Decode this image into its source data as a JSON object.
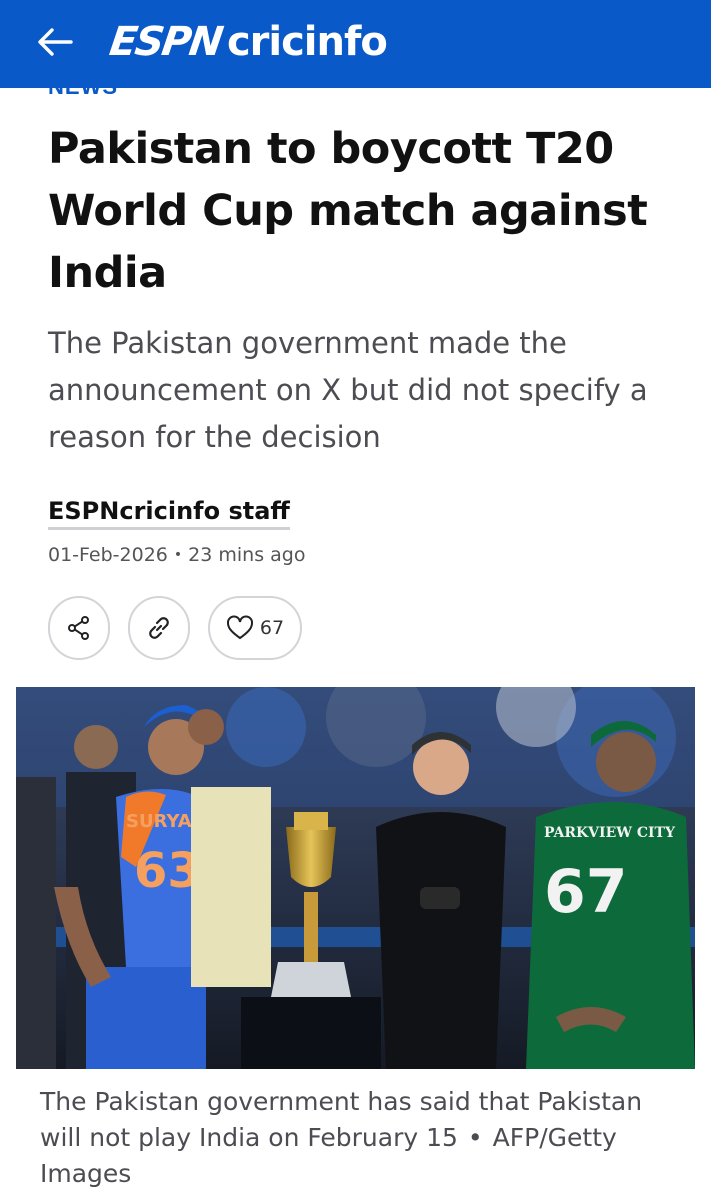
{
  "header": {
    "logo_espn": "ESPN",
    "logo_cricinfo": "cricinfo",
    "bg_color": "#0a59c8"
  },
  "section_label": "NEWS",
  "article": {
    "headline": "Pakistan to boycott T20 World Cup match against India",
    "summary": "The Pakistan government made the announcement on X but did not specify a reason for the decision",
    "author": "ESPNcricinfo staff",
    "date": "01-Feb-2026",
    "time_ago": "23 mins ago",
    "likes": "67"
  },
  "actions": {
    "share_icon": "share-icon",
    "link_icon": "link-icon",
    "like_icon": "heart-icon"
  },
  "photo": {
    "jersey_left_name": "SURYA",
    "jersey_left_number": "63",
    "jersey_right_text": "PARKVIEW CITY",
    "jersey_right_number": "67"
  },
  "caption": {
    "text": "The Pakistan government has said that Pakistan will not play India on February 15",
    "credit": "AFP/Getty Images"
  }
}
